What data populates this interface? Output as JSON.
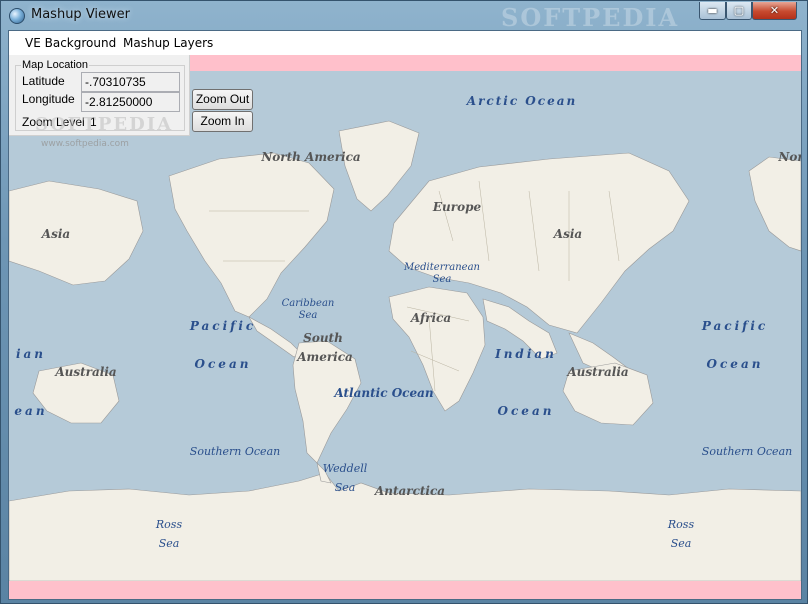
{
  "window": {
    "title": "Mashup Viewer",
    "watermark": "SOFTPEDIA",
    "controls": {
      "minimize": "▬",
      "maximize": "▢",
      "close": "✕"
    }
  },
  "menu": {
    "items": [
      "VE Background",
      "Mashup Layers"
    ]
  },
  "location_panel": {
    "group_label": "Map Location",
    "latitude_label": "Latitude",
    "latitude_value": "-.70310735",
    "longitude_label": "Longitude",
    "longitude_value": "-2.81250000",
    "zoom_label": "Zoom Level",
    "zoom_value": "1",
    "zoom_out_label": "Zoom Out",
    "zoom_in_label": "Zoom In"
  },
  "overlay": {
    "logo": "SOFTPEDIA",
    "url": "www.softpedia.com"
  },
  "map_labels": {
    "arctic_ocean": "Arctic Ocean",
    "north_america": "North America",
    "europe": "Europe",
    "asia_left": "Asia",
    "asia_right": "Asia",
    "mediterranean_1": "Mediterranean",
    "mediterranean_2": "Sea",
    "caribbean_1": "Caribbean",
    "caribbean_2": "Sea",
    "north_partial": "Nor",
    "pacific_left_1": "Pacific",
    "pacific_left_2": "Ocean",
    "pacific_right_1": "Pacific",
    "pacific_right_2": "Ocean",
    "south_america_1": "South",
    "south_america_2": "America",
    "africa": "Africa",
    "indian_1": "Indian",
    "indian_2": "Ocean",
    "indian_partial_1": "ian",
    "indian_partial_2": "ean",
    "australia_left": "Australia",
    "australia_right": "Australia",
    "atlantic": "Atlantic Ocean",
    "southern_left": "Southern Ocean",
    "southern_right": "Southern Ocean",
    "weddell_1": "Weddell",
    "weddell_2": "Sea",
    "antarctica": "Antarctica",
    "ross_left_1": "Ross",
    "ross_left_2": "Sea",
    "ross_right_1": "Ross",
    "ross_right_2": "Sea"
  },
  "colors": {
    "ocean": "#b5cad8",
    "land": "#f2efe6",
    "ocean_label": "#2a4f8c",
    "land_label": "#555555",
    "highlight": "#ffc0cb"
  }
}
